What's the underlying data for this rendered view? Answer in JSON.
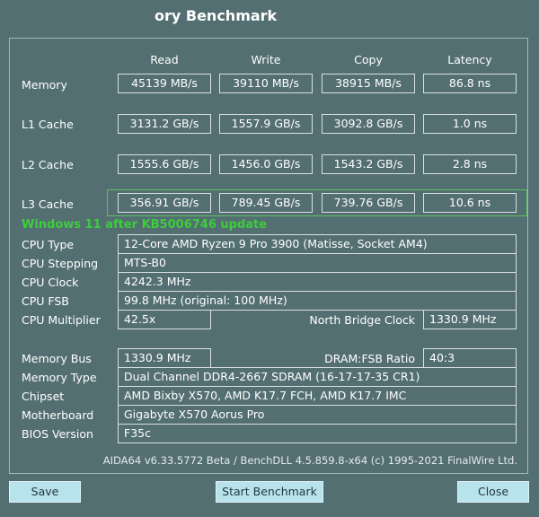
{
  "window": {
    "title": "ory Benchmark"
  },
  "columns": [
    "Read",
    "Write",
    "Copy",
    "Latency"
  ],
  "benchmark_rows": [
    {
      "label": "Memory",
      "values": [
        "45139 MB/s",
        "39110 MB/s",
        "38915 MB/s",
        "86.8 ns"
      ]
    },
    {
      "label": "L1 Cache",
      "values": [
        "3131.2 GB/s",
        "1557.9 GB/s",
        "3092.8 GB/s",
        "1.0 ns"
      ]
    },
    {
      "label": "L2 Cache",
      "values": [
        "1555.6 GB/s",
        "1456.0 GB/s",
        "1543.2 GB/s",
        "2.8 ns"
      ]
    },
    {
      "label": "L3 Cache",
      "values": [
        "356.91 GB/s",
        "789.45 GB/s",
        "739.76 GB/s",
        "10.6 ns"
      ]
    }
  ],
  "annotation": {
    "text": "Windows 11 after KB5006746 update",
    "color": "#3ccd3c"
  },
  "info": {
    "cpu_type": {
      "label": "CPU Type",
      "value": "12-Core AMD Ryzen 9 Pro 3900  (Matisse, Socket AM4)"
    },
    "cpu_stepping": {
      "label": "CPU Stepping",
      "value": "MTS-B0"
    },
    "cpu_clock": {
      "label": "CPU Clock",
      "value": "4242.3 MHz"
    },
    "cpu_fsb": {
      "label": "CPU FSB",
      "value": "99.8 MHz  (original: 100 MHz)"
    },
    "cpu_multiplier": {
      "label": "CPU Multiplier",
      "value": "42.5x"
    },
    "north_bridge_clock": {
      "label": "North Bridge Clock",
      "value": "1330.9 MHz"
    },
    "memory_bus": {
      "label": "Memory Bus",
      "value": "1330.9 MHz"
    },
    "dram_fsb_ratio": {
      "label": "DRAM:FSB Ratio",
      "value": "40:3"
    },
    "memory_type": {
      "label": "Memory Type",
      "value": "Dual Channel DDR4-2667 SDRAM  (16-17-17-35 CR1)"
    },
    "chipset": {
      "label": "Chipset",
      "value": "AMD Bixby X570, AMD K17.7 FCH, AMD K17.7 IMC"
    },
    "motherboard": {
      "label": "Motherboard",
      "value": "Gigabyte X570 Aorus Pro"
    },
    "bios_version": {
      "label": "BIOS Version",
      "value": "F35c"
    }
  },
  "footer": {
    "version_text": "AIDA64 v6.33.5772 Beta / BenchDLL 4.5.859.8-x64  (c) 1995-2021 FinalWire Ltd."
  },
  "buttons": {
    "save": "Save",
    "start": "Start Benchmark",
    "close": "Close"
  },
  "colors": {
    "background": "#546f72",
    "button": "#b8e3ec",
    "highlight_border": "#5fbf5f"
  }
}
